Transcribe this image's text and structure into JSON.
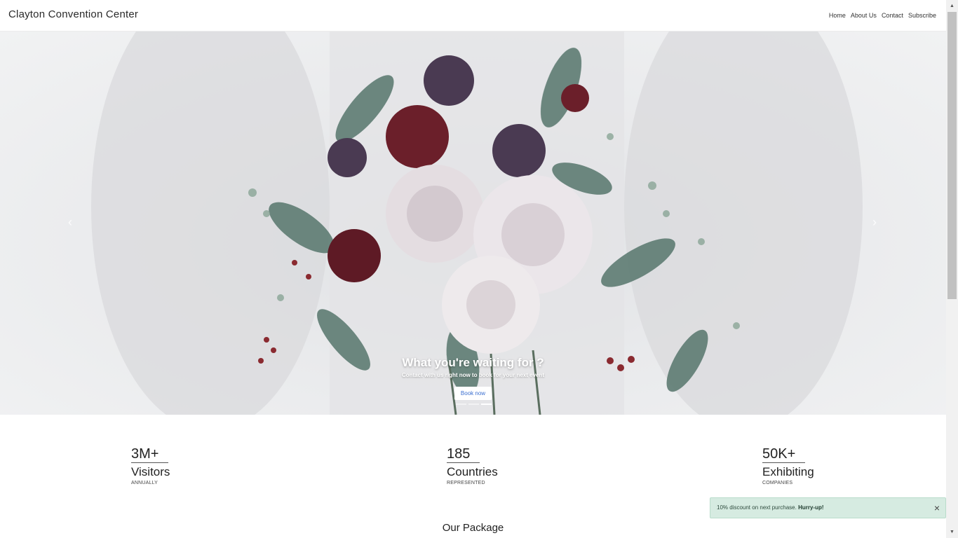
{
  "header": {
    "brand": "Clayton Convention Center",
    "nav": [
      "Home",
      "About Us",
      "Contact",
      "Subscribe"
    ]
  },
  "page_load_progress": 0.2,
  "hero": {
    "title": "What you're waiting for ?",
    "subtitle": "Contact with us right now to book for your next event",
    "button_label": "Book now",
    "slides_total": 3,
    "active_slide": 3,
    "prev_icon": "chevron-left-icon",
    "next_icon": "chevron-right-icon",
    "image_subject": "bridal flower bouquet"
  },
  "stats": [
    {
      "number": "3M+",
      "label": "Visitors",
      "sub": "ANNUALLY"
    },
    {
      "number": "185",
      "label": "Countries",
      "sub": "REPRESENTED"
    },
    {
      "number": "50K+",
      "label": "Exhibiting",
      "sub": "COMPANIES"
    }
  ],
  "section_title": "Our Package",
  "toast": {
    "message": "10% discount on next purchase.",
    "emphasis": "Hurry-up!",
    "close_icon": "close-icon"
  },
  "colors": {
    "accent": "#3b6fd0",
    "toast_bg": "#d6ebe1",
    "hero_bg": "#e9eaec"
  }
}
